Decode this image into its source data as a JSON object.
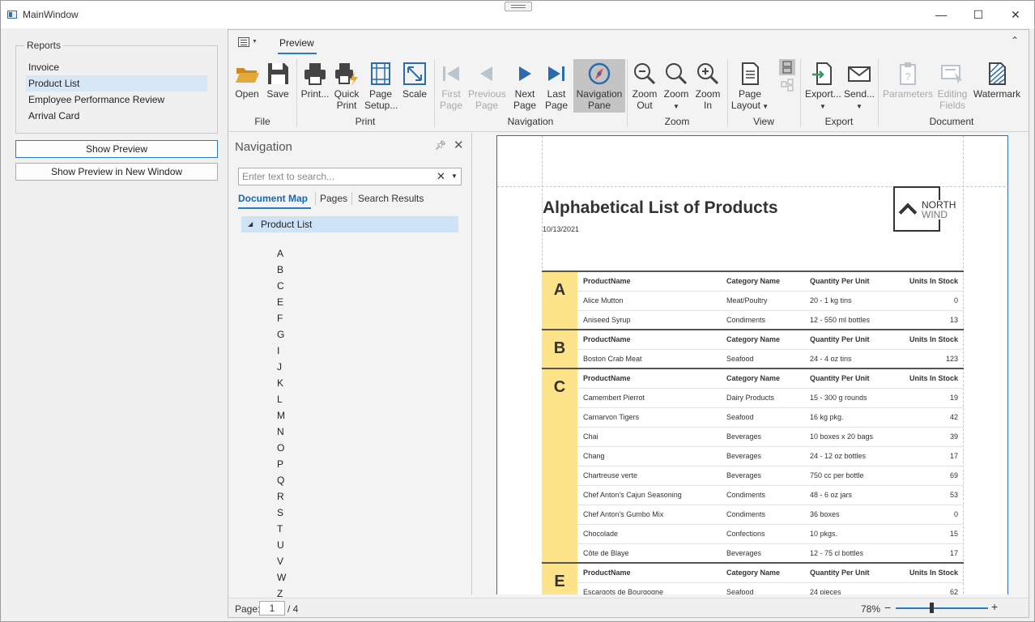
{
  "window": {
    "title": "MainWindow",
    "minimize": "—",
    "maximize": "☐",
    "close": "✕"
  },
  "reports": {
    "legend": "Reports",
    "items": [
      {
        "label": "Invoice",
        "selected": false
      },
      {
        "label": "Product List",
        "selected": true
      },
      {
        "label": "Employee Performance Review",
        "selected": false
      },
      {
        "label": "Arrival Card",
        "selected": false
      }
    ],
    "show_preview": "Show Preview",
    "show_preview_new": "Show Preview in New Window"
  },
  "ribbon": {
    "tab": "Preview",
    "groups": {
      "file": "File",
      "print": "Print",
      "navigation": "Navigation",
      "zoom": "Zoom",
      "view": "View",
      "export": "Export",
      "document": "Document"
    },
    "buttons": {
      "open": "Open",
      "save": "Save",
      "print": "Print...",
      "quick_print_1": "Quick",
      "quick_print_2": "Print",
      "page_setup_1": "Page",
      "page_setup_2": "Setup...",
      "scale": "Scale",
      "first_page_1": "First",
      "first_page_2": "Page",
      "previous_page_1": "Previous",
      "previous_page_2": "Page",
      "next_page_1": "Next",
      "next_page_2": "Page",
      "last_page_1": "Last",
      "last_page_2": "Page",
      "nav_pane_1": "Navigation",
      "nav_pane_2": "Pane",
      "zoom_out_1": "Zoom",
      "zoom_out_2": "Out",
      "zoom": "Zoom",
      "zoom_in_1": "Zoom",
      "zoom_in_2": "In",
      "page_layout_1": "Page",
      "page_layout_2": "Layout",
      "export": "Export...",
      "send": "Send...",
      "parameters": "Parameters",
      "editing_fields_1": "Editing",
      "editing_fields_2": "Fields",
      "watermark": "Watermark"
    },
    "icon_colors": {
      "folder": "#e3a93b",
      "accent": "#2b6cb0",
      "dark": "#444444",
      "disabled": "#b9c4cf"
    }
  },
  "navigation": {
    "title": "Navigation",
    "search_placeholder": "Enter text to search...",
    "tabs": [
      "Document Map",
      "Pages",
      "Search Results"
    ],
    "tree_root": "Product List",
    "letters": [
      "A",
      "B",
      "C",
      "E",
      "F",
      "G",
      "I",
      "J",
      "K",
      "L",
      "M",
      "N",
      "O",
      "P",
      "Q",
      "R",
      "S",
      "T",
      "U",
      "V",
      "W",
      "Z"
    ]
  },
  "report": {
    "title": "Alphabetical List of Products",
    "date": "10/13/2021",
    "logo_line1": "NORTH",
    "logo_line2": "WIND",
    "header": [
      "ProductName",
      "Category Name",
      "Quantity Per Unit",
      "Units In Stock"
    ],
    "highlight_color": "#fde38a",
    "sections": [
      {
        "letter": "A",
        "rows": [
          [
            "Alice Mutton",
            "Meat/Poultry",
            "20 - 1 kg tins",
            "0"
          ],
          [
            "Aniseed Syrup",
            "Condiments",
            "12 - 550 ml bottles",
            "13"
          ]
        ]
      },
      {
        "letter": "B",
        "rows": [
          [
            "Boston Crab Meat",
            "Seafood",
            "24 - 4 oz tins",
            "123"
          ]
        ]
      },
      {
        "letter": "C",
        "rows": [
          [
            "Camembert Pierrot",
            "Dairy Products",
            "15 - 300 g rounds",
            "19"
          ],
          [
            "Carnarvon Tigers",
            "Seafood",
            "16 kg pkg.",
            "42"
          ],
          [
            "Chai",
            "Beverages",
            "10 boxes x 20 bags",
            "39"
          ],
          [
            "Chang",
            "Beverages",
            "24 - 12 oz bottles",
            "17"
          ],
          [
            "Chartreuse verte",
            "Beverages",
            "750 cc per bottle",
            "69"
          ],
          [
            "Chef Anton's Cajun Seasoning",
            "Condiments",
            "48 - 6 oz jars",
            "53"
          ],
          [
            "Chef Anton's Gumbo Mix",
            "Condiments",
            "36 boxes",
            "0"
          ],
          [
            "Chocolade",
            "Confections",
            "10 pkgs.",
            "15"
          ],
          [
            "Côte de Blaye",
            "Beverages",
            "12 - 75 cl bottles",
            "17"
          ]
        ]
      },
      {
        "letter": "E",
        "rows": [
          [
            "Escargots de Bourgogne",
            "Seafood",
            "24 pieces",
            "62"
          ]
        ]
      }
    ]
  },
  "status": {
    "page_label": "Page:",
    "page_current": "1",
    "page_total": "/ 4",
    "zoom": "78%",
    "zoom_minus": "−",
    "zoom_plus": "+",
    "zoom_percent": 78
  }
}
